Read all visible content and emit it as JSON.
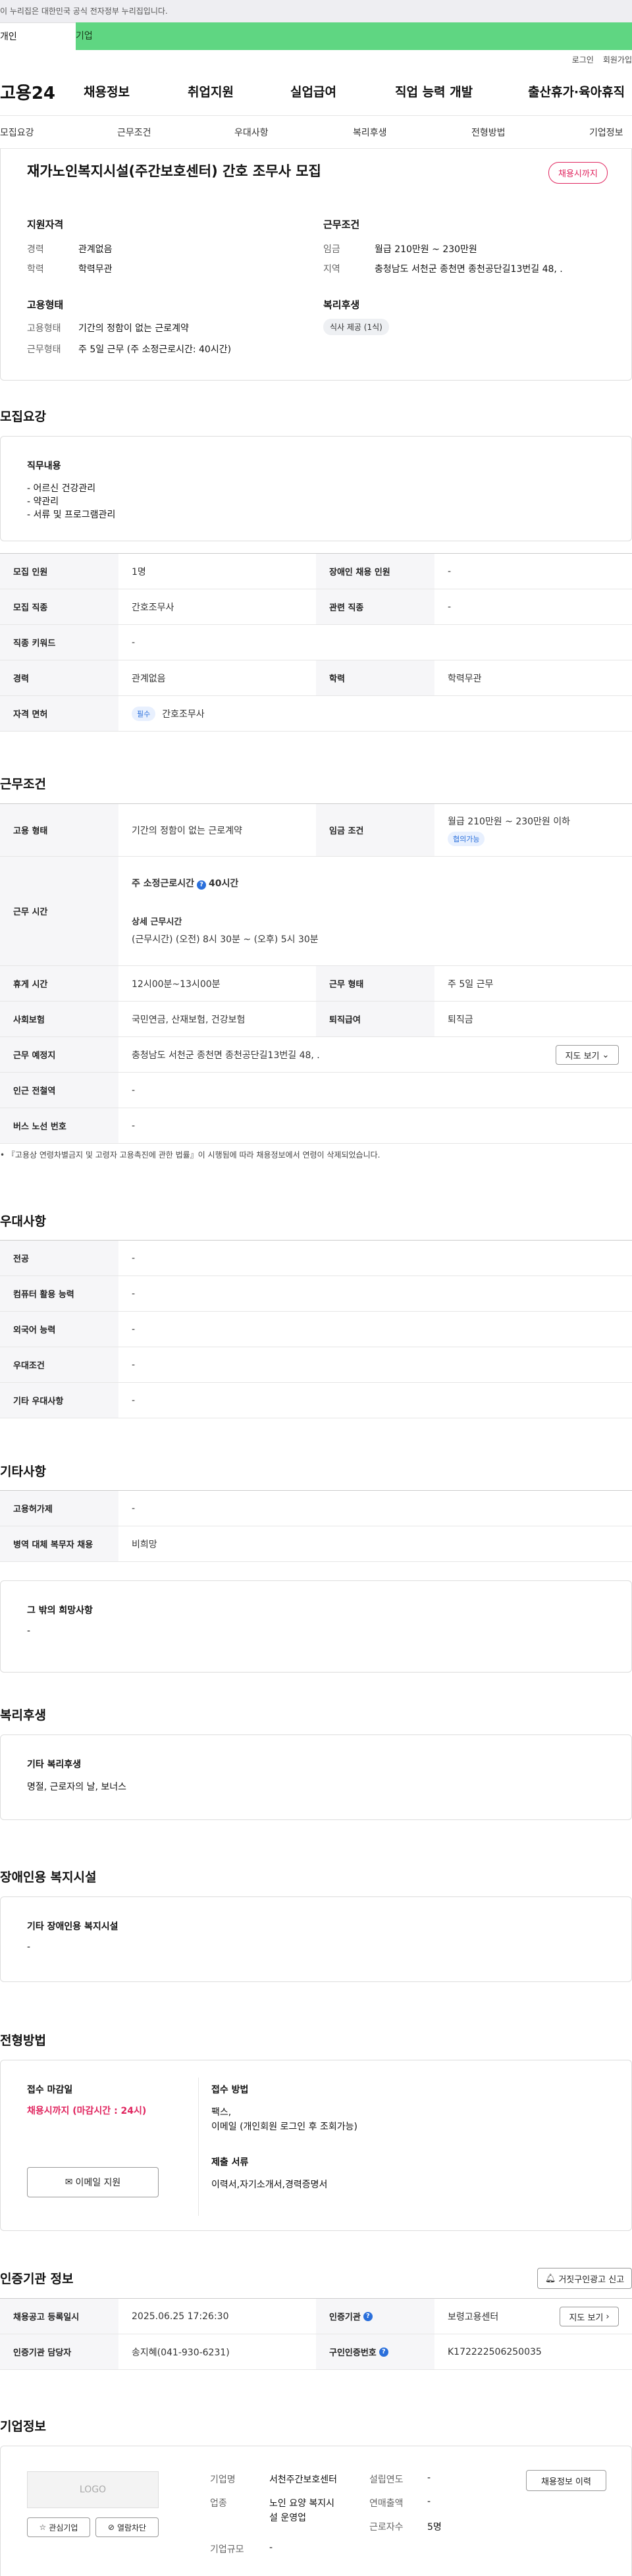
{
  "gov_banner": "이 누리집은 대한민국 공식 전자정부 누리집입니다.",
  "top_tabs": [
    "개인",
    "기업"
  ],
  "util": [
    "로그인",
    "회원가입"
  ],
  "logo": "고용24",
  "gnb": [
    "채용정보",
    "취업지원",
    "실업급여",
    "직업 능력 개발",
    "출산휴가·육아휴직"
  ],
  "subnav": [
    "모집요강",
    "근무조건",
    "우대사항",
    "복리후생",
    "전형방법",
    "기업정보"
  ],
  "title": "재가노인복지시설(주간보호센터) 간호 조무사 모집",
  "status_badge": "채용시까지",
  "summary": {
    "qual_title": "지원자격",
    "career_label": "경력",
    "career": "관계없음",
    "edu_label": "학력",
    "edu": "학력무관",
    "cond_title": "근무조건",
    "wage_label": "임금",
    "wage": "월급 210만원 ~ 230만원",
    "region_label": "지역",
    "region": "충청남도 서천군 종천면 종천공단길13번길 48, .",
    "emp_title": "고용형태",
    "emp_label": "고용형태",
    "emp": "기간의 정함이 없는 근로계약",
    "worktype_label": "근무형태",
    "worktype": "주 5일 근무 (주 소정근로시간: 40시간)",
    "welfare_title": "복리후생",
    "welfare_chip": "식사 제공 (1식)"
  },
  "recruit": {
    "heading": "모집요강",
    "duty_title": "직무내용",
    "duties": [
      "- 어르신 건강관리",
      "- 약관리",
      "- 서류 및 프로그램관리"
    ],
    "rows": [
      [
        "모집 인원",
        "1명",
        "장애인 채용 인원",
        "-"
      ],
      [
        "모집 직종",
        "간호조무사",
        "관련 직종",
        "-"
      ],
      [
        "직종 키워드",
        "-"
      ],
      [
        "경력",
        "관계없음",
        "학력",
        "학력무관"
      ]
    ],
    "license_label": "자격 면허",
    "license_tag": "필수",
    "license": "간호조무사"
  },
  "work": {
    "heading": "근무조건",
    "emp_label": "고용 형태",
    "emp": "기간의 정함이 없는 근로계약",
    "wage_label": "임금 조건",
    "wage": "월급 210만원 ~ 230만원 이하",
    "wage_tag": "협의가능",
    "time_label": "근무 시간",
    "time_main": "주 소정근로시간",
    "time_hours": "40시간",
    "detail_title": "상세 근무시간",
    "detail": "(근무시간) (오전) 8시 30분 ~ (오후) 5시 30분",
    "rows": [
      [
        "휴게 시간",
        "12시00분~13시00분",
        "근무 형태",
        "주 5일 근무"
      ],
      [
        "사회보험",
        "국민연금, 산재보험, 건강보험",
        "퇴직급여",
        "퇴직금"
      ]
    ],
    "place_label": "근무 예정지",
    "place": "충청남도 서천군 종천면 종천공단길13번길 48, .",
    "map_btn": "지도 보기",
    "rows2": [
      [
        "인근 전철역",
        "-"
      ],
      [
        "버스 노선 번호",
        "-"
      ]
    ],
    "note": "『고용상 연령차별금지 및 고령자 고용촉진에 관한 법률』이 시행됨에 따라 채용정보에서 연령이 삭제되었습니다."
  },
  "pref": {
    "heading": "우대사항",
    "rows": [
      [
        "전공",
        "-"
      ],
      [
        "컴퓨터 활용 능력",
        "-"
      ],
      [
        "외국어 능력",
        "-"
      ],
      [
        "우대조건",
        "-"
      ],
      [
        "기타 우대사항",
        "-"
      ]
    ]
  },
  "etc": {
    "heading": "기타사항",
    "rows": [
      [
        "고용허가제",
        "-"
      ],
      [
        "병역 대체 복무자 채용",
        "비희망"
      ]
    ],
    "box_title": "그 밖의 희망사항",
    "box_val": "-"
  },
  "welfare": {
    "heading": "복리후생",
    "title": "기타 복리후생",
    "val": "명절, 근로자의 날, 보너스"
  },
  "disab": {
    "heading": "장애인용 복지시설",
    "title": "기타 장애인용 복지시설",
    "val": "-"
  },
  "selection": {
    "heading": "전형방법",
    "deadline_title": "접수 마감일",
    "deadline": "채용시까지 (마감시간 : 24시)",
    "email_btn": "이메일 지원",
    "method_title": "접수 방법",
    "method": "팩스,",
    "method2": "이메일 (개인회원 로그인 후 조회가능)",
    "docs_title": "제출 서류",
    "docs": "이력서,자기소개서,경력증명서"
  },
  "cert": {
    "heading": "인증기관 정보",
    "report_btn": "거짓구인광고 신고",
    "reg_label": "채용공고 등록일시",
    "reg": "2025.06.25 17:26:30",
    "org_label": "인증기관",
    "org": "보령고용센터",
    "contact_label": "인증기관 담당자",
    "contact": "송지혜(041-930-6231)",
    "num_label": "구인인증번호",
    "num": "K172222506250035",
    "map_btn": "지도 보기"
  },
  "company": {
    "heading": "기업정보",
    "logo": "LOGO",
    "fav_btn": "관심기업",
    "block_btn": "열람차단",
    "name_label": "기업명",
    "name": "서천주간보호센터",
    "industry_label": "업종",
    "industry": "노인 요양 복지시설 운영업",
    "size_label": "기업규모",
    "size": "-",
    "year_label": "설립연도",
    "year": "-",
    "sales_label": "연매출액",
    "sales": "-",
    "emp_label": "근로자수",
    "emp": "5명",
    "history_btn": "채용정보 이력"
  }
}
